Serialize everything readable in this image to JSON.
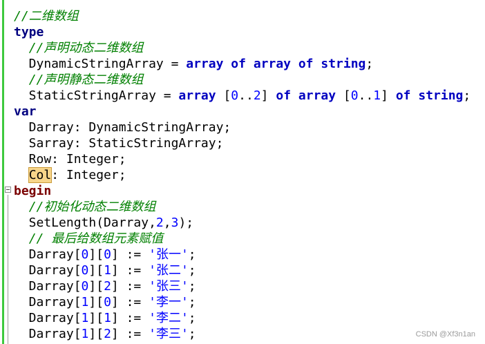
{
  "lines": [
    [
      {
        "t": "//二维数组",
        "c": "cm"
      }
    ],
    [
      {
        "t": "type",
        "c": "kw2"
      }
    ],
    [
      {
        "t": "  "
      },
      {
        "t": "//声明动态二维数组",
        "c": "cm"
      }
    ],
    [
      {
        "t": "  DynamicStringArray = "
      },
      {
        "t": "array",
        "c": "kw"
      },
      {
        "t": " "
      },
      {
        "t": "of",
        "c": "kw"
      },
      {
        "t": " "
      },
      {
        "t": "array",
        "c": "kw"
      },
      {
        "t": " "
      },
      {
        "t": "of",
        "c": "kw"
      },
      {
        "t": " "
      },
      {
        "t": "string",
        "c": "kw"
      },
      {
        "t": ";"
      }
    ],
    [
      {
        "t": "  "
      },
      {
        "t": "//声明静态二维数组",
        "c": "cm"
      }
    ],
    [
      {
        "t": "  StaticStringArray = "
      },
      {
        "t": "array",
        "c": "kw"
      },
      {
        "t": " ["
      },
      {
        "t": "0",
        "c": "num"
      },
      {
        "t": ".."
      },
      {
        "t": "2",
        "c": "num"
      },
      {
        "t": "] "
      },
      {
        "t": "of",
        "c": "kw"
      },
      {
        "t": " "
      },
      {
        "t": "array",
        "c": "kw"
      },
      {
        "t": " ["
      },
      {
        "t": "0",
        "c": "num"
      },
      {
        "t": ".."
      },
      {
        "t": "1",
        "c": "num"
      },
      {
        "t": "] "
      },
      {
        "t": "of",
        "c": "kw"
      },
      {
        "t": " "
      },
      {
        "t": "string",
        "c": "kw"
      },
      {
        "t": ";"
      }
    ],
    [
      {
        "t": "var",
        "c": "kw2"
      }
    ],
    [
      {
        "t": "  Darray: DynamicStringArray;"
      }
    ],
    [
      {
        "t": "  Sarray: StaticStringArray;"
      }
    ],
    [
      {
        "t": "  Row: Integer;"
      }
    ],
    [
      {
        "t": "  "
      },
      {
        "t": "Col",
        "c": "hl"
      },
      {
        "t": ": Integer;"
      }
    ],
    [
      {
        "t": "begin",
        "c": "kwb"
      }
    ],
    [
      {
        "t": "  "
      },
      {
        "t": "//初始化动态二维数组",
        "c": "cm"
      }
    ],
    [
      {
        "t": "  SetLength(Darray,"
      },
      {
        "t": "2",
        "c": "num"
      },
      {
        "t": ","
      },
      {
        "t": "3",
        "c": "num"
      },
      {
        "t": ");"
      }
    ],
    [
      {
        "t": "  "
      },
      {
        "t": "// 最后给数组元素赋值",
        "c": "cm"
      }
    ],
    [
      {
        "t": "  Darray["
      },
      {
        "t": "0",
        "c": "num"
      },
      {
        "t": "]["
      },
      {
        "t": "0",
        "c": "num"
      },
      {
        "t": "] := "
      },
      {
        "t": "'张一'",
        "c": "str"
      },
      {
        "t": ";"
      }
    ],
    [
      {
        "t": "  Darray["
      },
      {
        "t": "0",
        "c": "num"
      },
      {
        "t": "]["
      },
      {
        "t": "1",
        "c": "num"
      },
      {
        "t": "] := "
      },
      {
        "t": "'张二'",
        "c": "str"
      },
      {
        "t": ";"
      }
    ],
    [
      {
        "t": "  Darray["
      },
      {
        "t": "0",
        "c": "num"
      },
      {
        "t": "]["
      },
      {
        "t": "2",
        "c": "num"
      },
      {
        "t": "] := "
      },
      {
        "t": "'张三'",
        "c": "str"
      },
      {
        "t": ";"
      }
    ],
    [
      {
        "t": "  Darray["
      },
      {
        "t": "1",
        "c": "num"
      },
      {
        "t": "]["
      },
      {
        "t": "0",
        "c": "num"
      },
      {
        "t": "] := "
      },
      {
        "t": "'李一'",
        "c": "str"
      },
      {
        "t": ";"
      }
    ],
    [
      {
        "t": "  Darray["
      },
      {
        "t": "1",
        "c": "num"
      },
      {
        "t": "]["
      },
      {
        "t": "1",
        "c": "num"
      },
      {
        "t": "] := "
      },
      {
        "t": "'李二'",
        "c": "str"
      },
      {
        "t": ";"
      }
    ],
    [
      {
        "t": "  Darray["
      },
      {
        "t": "1",
        "c": "num"
      },
      {
        "t": "]["
      },
      {
        "t": "2",
        "c": "num"
      },
      {
        "t": "] := "
      },
      {
        "t": "'李三'",
        "c": "str"
      },
      {
        "t": ";"
      }
    ]
  ],
  "watermark": "CSDN @Xf3n1an",
  "colors": {
    "keyword": "#0000c0",
    "begin_keyword": "#7a0000",
    "comment": "#008000",
    "number": "#0000ff",
    "gutter": "#3ec93e",
    "highlight": "#f7d58a"
  }
}
